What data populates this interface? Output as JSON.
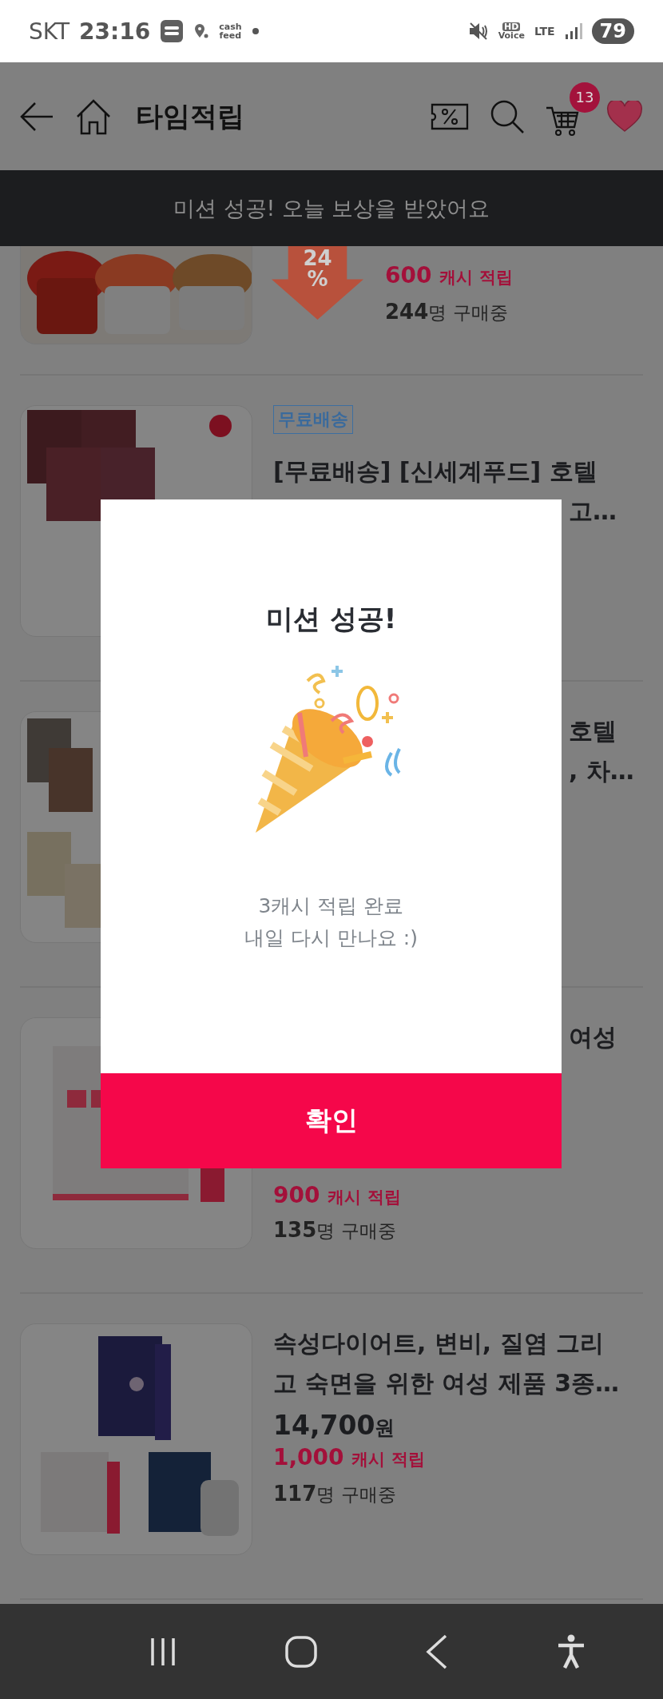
{
  "status_bar": {
    "carrier": "SKT",
    "time": "23:16",
    "app_badge": [
      "cash",
      "feed"
    ],
    "hd": [
      "HD",
      "Voice"
    ],
    "network": "LTE",
    "battery": "79"
  },
  "header": {
    "title": "타임적립",
    "cart_count": "13"
  },
  "toast": "미션 성공! 오늘 보상을 받았어요",
  "products": [
    {
      "discount_value": "24",
      "discount_unit": "%",
      "cashback_amount": "600",
      "cashback_label": "캐시 적립",
      "buyers_count": "244",
      "buyers_label": "명 구매중"
    },
    {
      "tag": "무료배송",
      "title_lines": [
        {
          "text": "[무료배송] [신세계푸드] 호텔",
          "covered": false
        },
        {
          "text": "고…",
          "covered": true
        }
      ]
    },
    {
      "title_lines": [
        {
          "text": "호텔",
          "covered": true
        },
        {
          "text": ", 차…",
          "covered": true
        }
      ]
    },
    {
      "title_lines": [
        {
          "text": "여성",
          "covered": true
        }
      ],
      "cashback_amount": "900",
      "cashback_label": "캐시 적립",
      "buyers_count": "135",
      "buyers_label": "명 구매중"
    },
    {
      "title_lines": [
        {
          "text": "속성다이어트, 변비, 질염 그리",
          "covered": false
        },
        {
          "text": "고 숙면을 위한 여성 제품 3종…",
          "covered": false
        }
      ],
      "price": "14,700",
      "price_unit": "원",
      "cashback_amount": "1,000",
      "cashback_label": "캐시 적립",
      "buyers_count": "117",
      "buyers_label": "명 구매중"
    }
  ],
  "dialog": {
    "title": "미션 성공!",
    "message_lines": [
      "3캐시 적립 완료",
      "내일 다시 만나요 :)"
    ],
    "confirm": "확인"
  }
}
